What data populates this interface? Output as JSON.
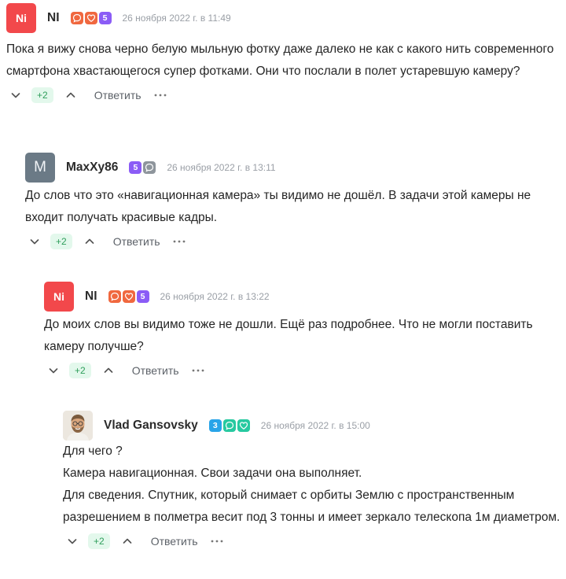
{
  "comments": [
    {
      "author": "NI",
      "avatar_text": "Ni",
      "avatar_style": "red",
      "badges": [
        "comment-icon",
        "heart-icon",
        "5"
      ],
      "date": "26 ноября 2022 г. в 11:49",
      "text": "Пока я вижу снова черно белую мыльную фотку даже далеко не как с какого нить современного смартфона хвастающегося супер фотками. Они что послали в полет устаревшую камеру?",
      "score": "+2",
      "reply_label": "Ответить"
    },
    {
      "author": "MaxXy86",
      "avatar_text": "M",
      "avatar_style": "gray",
      "badges": [
        "5",
        "comment-icon"
      ],
      "date": "26 ноября 2022 г. в 13:11",
      "text": "До слов что это «навигационная камера» ты видимо не дошёл. В задачи этой камеры не входит получать красивые кадры.",
      "score": "+2",
      "reply_label": "Ответить"
    },
    {
      "author": "NI",
      "avatar_text": "Ni",
      "avatar_style": "red",
      "badges": [
        "comment-icon",
        "heart-icon",
        "5"
      ],
      "date": "26 ноября 2022 г. в 13:22",
      "text": "До моих слов вы видимо тоже не дошли. Ещё раз подробнее. Что не могли поставить камеру получше?",
      "score": "+2",
      "reply_label": "Ответить"
    },
    {
      "author": "Vlad Gansovsky",
      "avatar_text": "",
      "avatar_style": "photo",
      "badges": [
        "3",
        "comment-icon",
        "heart-icon"
      ],
      "date": "26 ноября 2022 г. в 15:00",
      "text_lines": [
        "Для чего ?",
        "Камера навигационная. Свои задачи она выполняет.",
        "Для сведения. Спутник, который снимает с орбиты Землю с пространственным разрешением в полметра весит под 3 тонны и имеет зеркало телескопа 1м диаметром."
      ],
      "score": "+2",
      "reply_label": "Ответить"
    }
  ],
  "colors": {
    "accent_red": "#f2484b",
    "score_green": "#2f9e5b",
    "score_bg": "#e3f8ec",
    "level_purple": "#8b5cf6",
    "level_blue": "#28a4e8",
    "date_gray": "#9a9fa6"
  }
}
